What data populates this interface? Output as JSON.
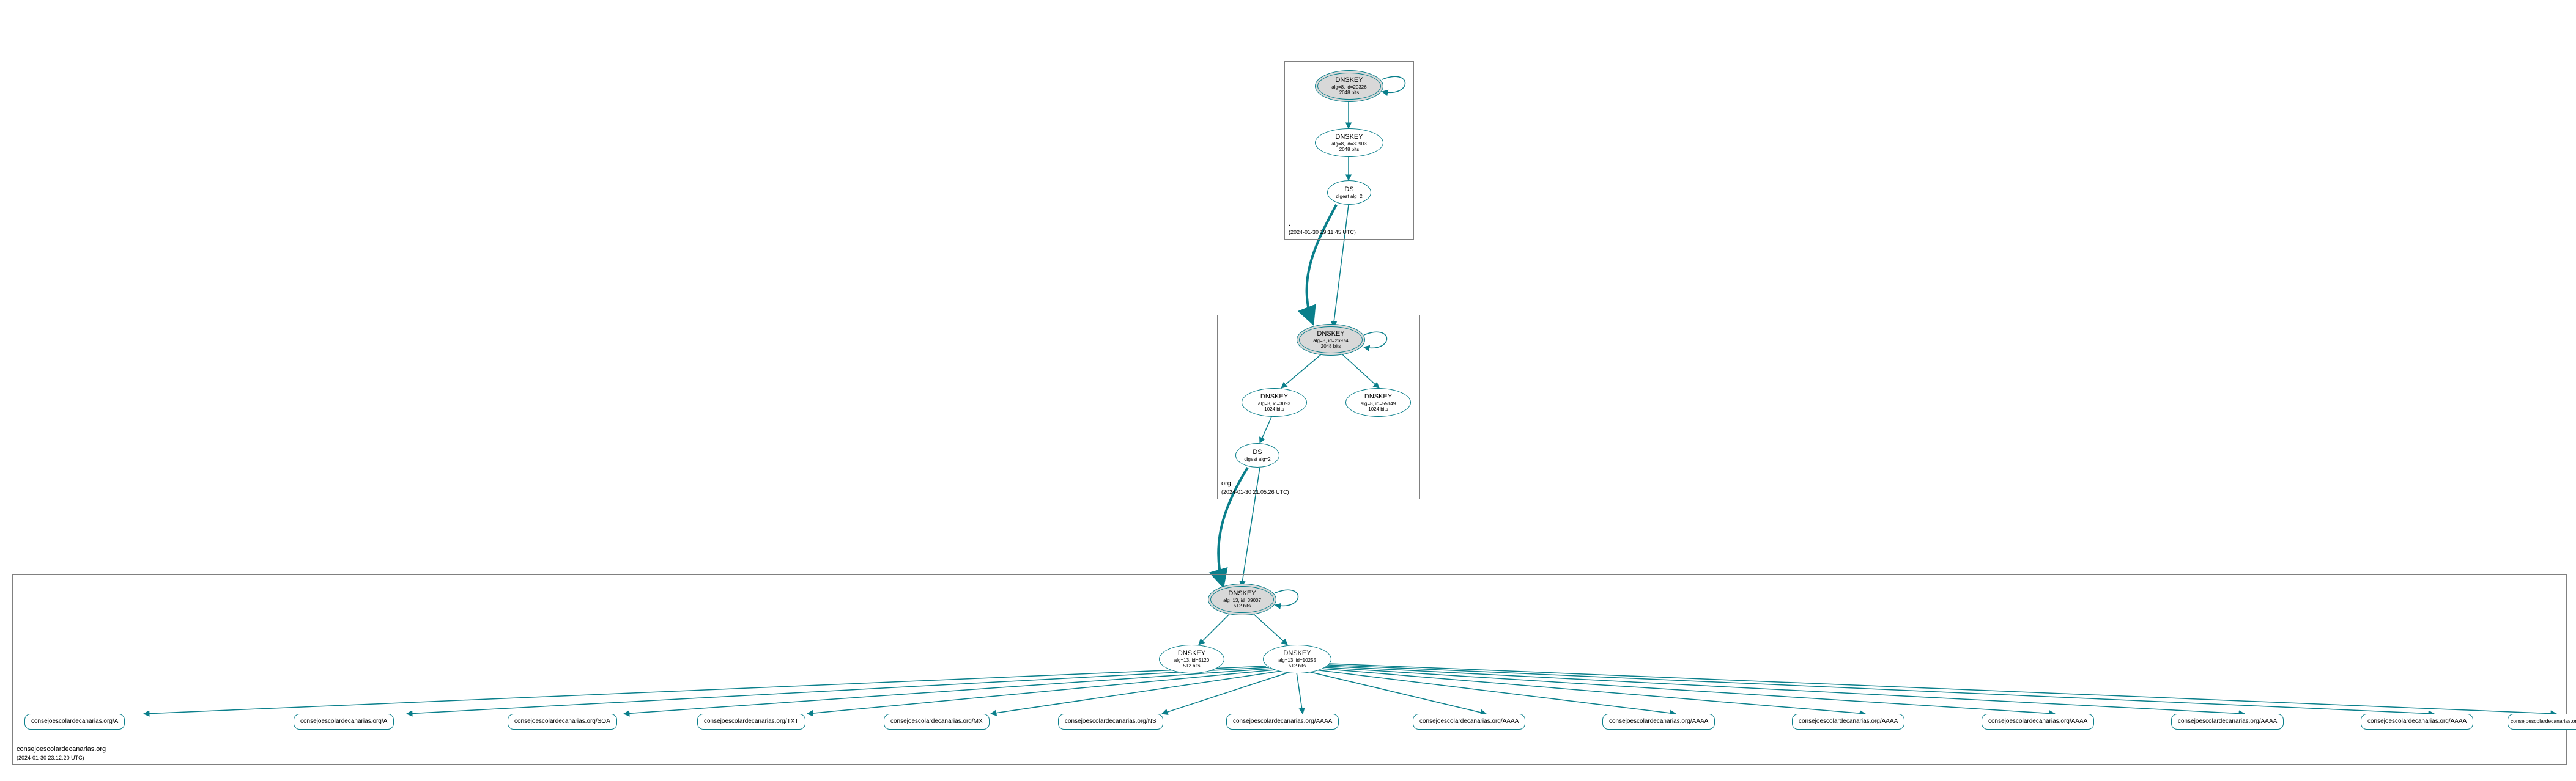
{
  "colors": {
    "stroke": "#0a7f8b",
    "sep_fill": "#d8d8d8"
  },
  "zones": {
    "root": {
      "label_top": ".",
      "label_bottom": "(2024-01-30 19:11:45 UTC)"
    },
    "org": {
      "label_top": "org",
      "label_bottom": "(2024-01-30 21:05:26 UTC)"
    },
    "leaf": {
      "label_top": "consejoescolardecanarias.org",
      "label_bottom": "(2024-01-30 23:12:20 UTC)"
    }
  },
  "nodes": {
    "root_ksk": {
      "title": "DNSKEY",
      "sub1": "alg=8, id=20326",
      "sub2": "2048 bits"
    },
    "root_zsk": {
      "title": "DNSKEY",
      "sub1": "alg=8, id=30903",
      "sub2": "2048 bits"
    },
    "root_ds": {
      "title": "DS",
      "sub1": "digest alg=2",
      "sub2": ""
    },
    "org_ksk": {
      "title": "DNSKEY",
      "sub1": "alg=8, id=26974",
      "sub2": "2048 bits"
    },
    "org_zsk1": {
      "title": "DNSKEY",
      "sub1": "alg=8, id=3093",
      "sub2": "1024 bits"
    },
    "org_zsk2": {
      "title": "DNSKEY",
      "sub1": "alg=8, id=55149",
      "sub2": "1024 bits"
    },
    "org_ds": {
      "title": "DS",
      "sub1": "digest alg=2",
      "sub2": ""
    },
    "leaf_ksk": {
      "title": "DNSKEY",
      "sub1": "alg=13, id=39007",
      "sub2": "512 bits"
    },
    "leaf_zsk1": {
      "title": "DNSKEY",
      "sub1": "alg=13, id=5120",
      "sub2": "512 bits"
    },
    "leaf_zsk2": {
      "title": "DNSKEY",
      "sub1": "alg=13, id=10255",
      "sub2": "512 bits"
    }
  },
  "records": {
    "r0": "consejoescolardecanarias.org/A",
    "r1": "consejoescolardecanarias.org/A",
    "r2": "consejoescolardecanarias.org/SOA",
    "r3": "consejoescolardecanarias.org/TXT",
    "r4": "consejoescolardecanarias.org/MX",
    "r5": "consejoescolardecanarias.org/NS",
    "r6": "consejoescolardecanarias.org/AAAA",
    "r7": "consejoescolardecanarias.org/AAAA",
    "r8": "consejoescolardecanarias.org/AAAA",
    "r9": "consejoescolardecanarias.org/AAAA",
    "r10": "consejoescolardecanarias.org/AAAA",
    "r11": "consejoescolardecanarias.org/AAAA",
    "r12": "consejoescolardecanarias.org/AAAA",
    "r13": "consejoescolardecanarias.org/AAAA"
  },
  "chart_data": {
    "type": "dnssec-delegation-graph",
    "zones": [
      {
        "name": ".",
        "timestamp": "2024-01-30 19:11:45 UTC",
        "keys": [
          {
            "kind": "DNSKEY",
            "alg": 8,
            "id": 20326,
            "bits": 2048,
            "role": "KSK",
            "self_signed": true
          },
          {
            "kind": "DNSKEY",
            "alg": 8,
            "id": 30903,
            "bits": 2048,
            "role": "ZSK"
          }
        ],
        "ds": [
          {
            "digest_alg": 2,
            "for_child": "org"
          }
        ]
      },
      {
        "name": "org",
        "timestamp": "2024-01-30 21:05:26 UTC",
        "keys": [
          {
            "kind": "DNSKEY",
            "alg": 8,
            "id": 26974,
            "bits": 2048,
            "role": "KSK",
            "self_signed": true
          },
          {
            "kind": "DNSKEY",
            "alg": 8,
            "id": 3093,
            "bits": 1024,
            "role": "ZSK"
          },
          {
            "kind": "DNSKEY",
            "alg": 8,
            "id": 55149,
            "bits": 1024,
            "role": "ZSK"
          }
        ],
        "ds": [
          {
            "digest_alg": 2,
            "for_child": "consejoescolardecanarias.org"
          }
        ]
      },
      {
        "name": "consejoescolardecanarias.org",
        "timestamp": "2024-01-30 23:12:20 UTC",
        "keys": [
          {
            "kind": "DNSKEY",
            "alg": 13,
            "id": 39007,
            "bits": 512,
            "role": "KSK",
            "self_signed": true
          },
          {
            "kind": "DNSKEY",
            "alg": 13,
            "id": 5120,
            "bits": 512,
            "role": "ZSK"
          },
          {
            "kind": "DNSKEY",
            "alg": 13,
            "id": 10255,
            "bits": 512,
            "role": "ZSK"
          }
        ],
        "rrsets_signed": [
          "consejoescolardecanarias.org/A",
          "consejoescolardecanarias.org/A",
          "consejoescolardecanarias.org/SOA",
          "consejoescolardecanarias.org/TXT",
          "consejoescolardecanarias.org/MX",
          "consejoescolardecanarias.org/NS",
          "consejoescolardecanarias.org/AAAA",
          "consejoescolardecanarias.org/AAAA",
          "consejoescolardecanarias.org/AAAA",
          "consejoescolardecanarias.org/AAAA",
          "consejoescolardecanarias.org/AAAA",
          "consejoescolardecanarias.org/AAAA",
          "consejoescolardecanarias.org/AAAA",
          "consejoescolardecanarias.org/AAAA"
        ]
      }
    ],
    "edges": [
      {
        "from": "./DNSKEY/20326",
        "to": "./DNSKEY/20326",
        "kind": "self-sign"
      },
      {
        "from": "./DNSKEY/20326",
        "to": "./DNSKEY/30903",
        "kind": "sign"
      },
      {
        "from": "./DNSKEY/30903",
        "to": "./DS(org)",
        "kind": "sign"
      },
      {
        "from": "./DS(org)",
        "to": "org/DNSKEY/26974",
        "kind": "delegation"
      },
      {
        "from": "org/DNSKEY/26974",
        "to": "org/DNSKEY/26974",
        "kind": "self-sign"
      },
      {
        "from": "org/DNSKEY/26974",
        "to": "org/DNSKEY/3093",
        "kind": "sign"
      },
      {
        "from": "org/DNSKEY/26974",
        "to": "org/DNSKEY/55149",
        "kind": "sign"
      },
      {
        "from": "org/DNSKEY/3093",
        "to": "org/DS(consejoescolardecanarias.org)",
        "kind": "sign"
      },
      {
        "from": "org/DS(consejoescolardecanarias.org)",
        "to": "consejoescolardecanarias.org/DNSKEY/39007",
        "kind": "delegation"
      },
      {
        "from": "consejoescolardecanarias.org/DNSKEY/39007",
        "to": "consejoescolardecanarias.org/DNSKEY/39007",
        "kind": "self-sign"
      },
      {
        "from": "consejoescolardecanarias.org/DNSKEY/39007",
        "to": "consejoescolardecanarias.org/DNSKEY/5120",
        "kind": "sign"
      },
      {
        "from": "consejoescolardecanarias.org/DNSKEY/39007",
        "to": "consejoescolardecanarias.org/DNSKEY/10255",
        "kind": "sign"
      },
      {
        "from": "consejoescolardecanarias.org/DNSKEY/10255",
        "to": "rrsets",
        "kind": "sign-all"
      }
    ]
  }
}
